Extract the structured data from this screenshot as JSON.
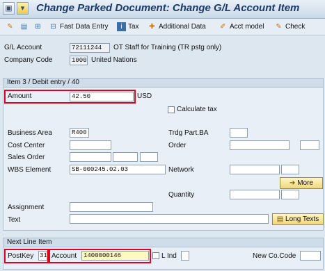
{
  "window": {
    "title": "Change Parked Document: Change G/L Account Item",
    "title_icons": [
      "save-icon",
      "back-icon"
    ]
  },
  "toolbar": {
    "fast_data_entry": "Fast Data Entry",
    "tax": "Tax",
    "additional_data": "Additional Data",
    "acct_model": "Acct model",
    "check": "Check"
  },
  "header": {
    "gl_account_label": "G/L Account",
    "gl_account_value": "72111244",
    "gl_account_desc": "OT Staff  for Training (TR pstg only)",
    "company_code_label": "Company Code",
    "company_code_value": "1000",
    "company_code_desc": "United Nations"
  },
  "item": {
    "section_title": "Item 3 / Debit entry / 40",
    "amount_label": "Amount",
    "amount_value": "42.50",
    "currency": "USD",
    "calculate_tax_label": "Calculate tax",
    "business_area_label": "Business Area",
    "business_area_value": "R400",
    "trdg_part_label": "Trdg Part.BA",
    "cost_center_label": "Cost Center",
    "order_label": "Order",
    "sales_order_label": "Sales Order",
    "wbs_label": "WBS Element",
    "wbs_value": "SB-000245.02.03",
    "network_label": "Network",
    "more_label": "More",
    "quantity_label": "Quantity",
    "assignment_label": "Assignment",
    "text_label": "Text",
    "long_texts_label": "Long Texts"
  },
  "next_line": {
    "section_title": "Next Line Item",
    "postkey_label": "PostKey",
    "postkey_value": "31",
    "account_label": "Account",
    "account_value": "1400000146",
    "lind_label": "L Ind",
    "new_cocode_label": "New Co.Code"
  },
  "colors": {
    "highlight": "#e3001b",
    "title_text": "#1b3a66",
    "background": "#dde7f0"
  }
}
